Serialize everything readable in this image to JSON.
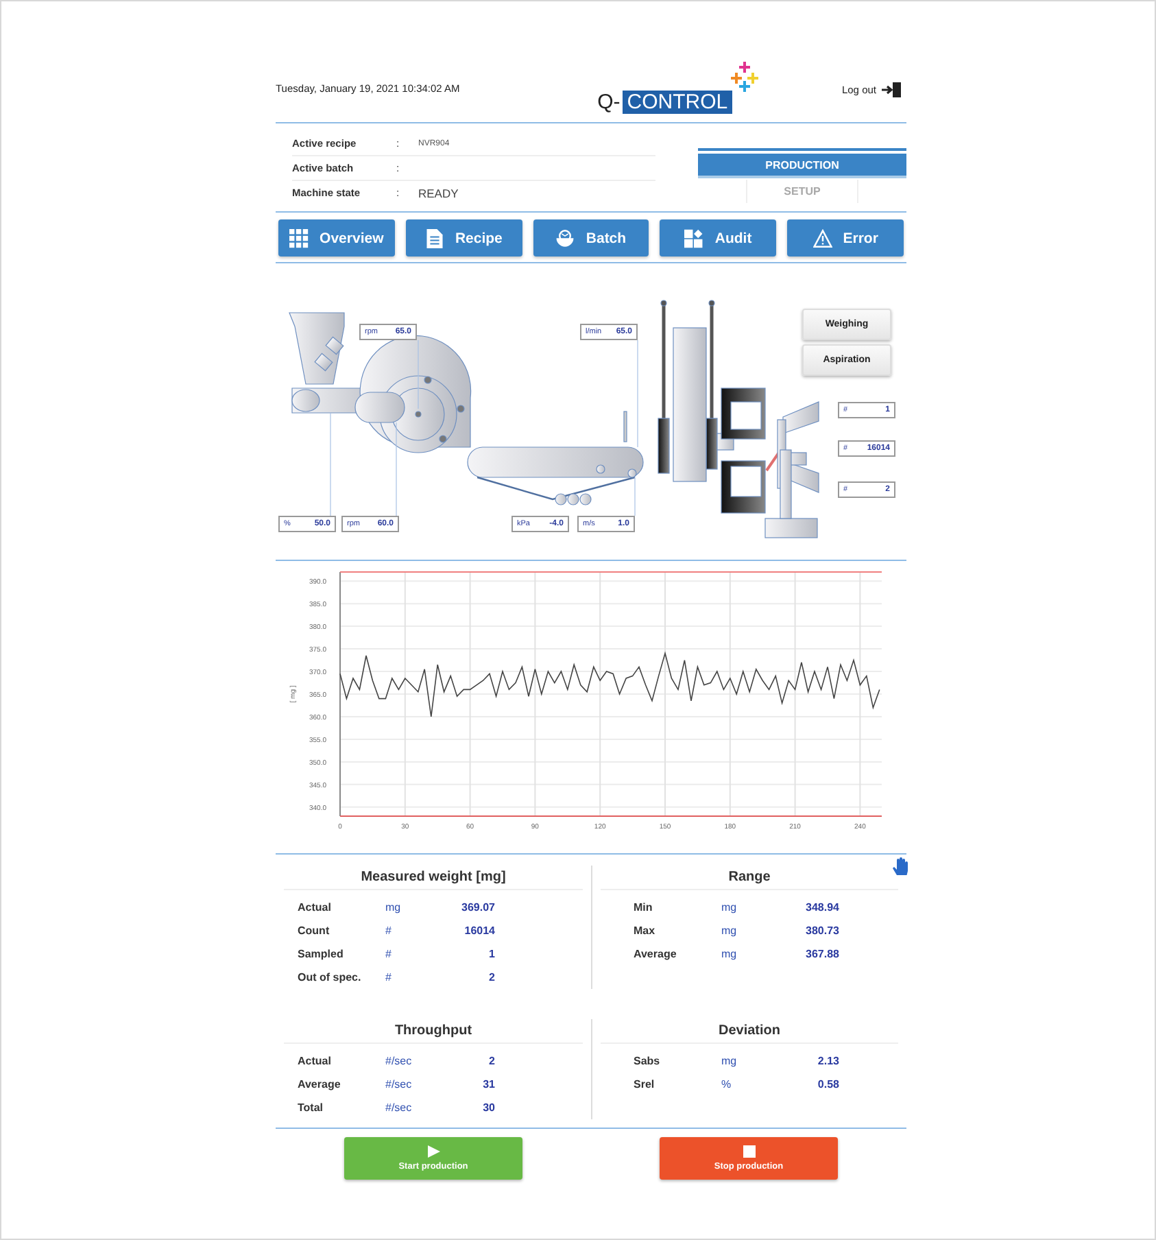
{
  "header": {
    "datetime": "Tuesday, January 19, 2021 10:34:02 AM",
    "logo": {
      "prefix": "Q-",
      "name": "CONTROL"
    },
    "logout": "Log out"
  },
  "info": [
    {
      "label": "Active recipe",
      "sep": ":",
      "value": "NVR904",
      "kind": "small"
    },
    {
      "label": "Active batch",
      "sep": ":"
    },
    {
      "label": "Machine state",
      "sep": ":",
      "value": "READY",
      "kind": "large"
    }
  ],
  "modes": [
    {
      "label": "PRODUCTION",
      "selected": true
    },
    {
      "label": "SETUP",
      "selected": false
    }
  ],
  "nav": [
    {
      "label": "Overview",
      "kind": "grid"
    },
    {
      "label": "Recipe",
      "kind": "document"
    },
    {
      "label": "Batch",
      "kind": "bowl"
    },
    {
      "label": "Audit",
      "kind": "audit"
    },
    {
      "label": "Error",
      "kind": "warning"
    }
  ],
  "diagram": {
    "readouts": [
      {
        "unit": "rpm",
        "value": "65.0"
      },
      {
        "unit": "l/min",
        "value": "65.0"
      },
      {
        "unit": "%",
        "value": "50.0"
      },
      {
        "unit": "rpm",
        "value": "60.0"
      },
      {
        "unit": "kPa",
        "value": "-4.0"
      },
      {
        "unit": "m/s",
        "value": "1.0"
      },
      {
        "unit": "#",
        "value": "1"
      },
      {
        "unit": "#",
        "value": "16014"
      },
      {
        "unit": "#",
        "value": "2"
      }
    ],
    "buttons": [
      "Weighing",
      "Aspiration"
    ]
  },
  "chart": {
    "chart_data": {
      "type": "line",
      "ylabel": "[ mg ]",
      "xlim": [
        0,
        250
      ],
      "grid": true,
      "ylim": [
        338,
        392
      ],
      "xticks": [
        0,
        30,
        60,
        90,
        120,
        150,
        180,
        210,
        240
      ],
      "yticks": [
        {
          "value": 340,
          "label": "340.0"
        },
        {
          "value": 345,
          "label": "345.0"
        },
        {
          "value": 350,
          "label": "350.0"
        },
        {
          "value": 355,
          "label": "355.0"
        },
        {
          "value": 360,
          "label": "360.0"
        },
        {
          "value": 365,
          "label": "365.0"
        },
        {
          "value": 370,
          "label": "370.0"
        },
        {
          "value": 375,
          "label": "375.0"
        },
        {
          "value": 380,
          "label": "380.0"
        },
        {
          "value": 385,
          "label": "385.0"
        },
        {
          "value": 390,
          "label": "390.0"
        }
      ],
      "x": [
        0,
        3,
        6,
        9,
        12,
        15,
        18,
        21,
        24,
        27,
        30,
        33,
        36,
        39,
        42,
        45,
        48,
        51,
        54,
        57,
        60,
        63,
        66,
        69,
        72,
        75,
        78,
        81,
        84,
        87,
        90,
        93,
        96,
        99,
        102,
        105,
        108,
        111,
        114,
        117,
        120,
        123,
        126,
        129,
        132,
        135,
        138,
        141,
        144,
        147,
        150,
        153,
        156,
        159,
        162,
        165,
        168,
        171,
        174,
        177,
        180,
        183,
        186,
        189,
        192,
        195,
        198,
        201,
        204,
        207,
        210,
        213,
        216,
        219,
        222,
        225,
        228,
        231,
        234,
        237,
        240,
        243,
        246,
        249
      ],
      "series": [
        {
          "color": "#444444",
          "values": [
            369.5,
            364,
            368.5,
            366,
            373.5,
            368,
            364,
            364,
            368.5,
            366,
            368.5,
            367,
            365.5,
            370.5,
            360,
            371.5,
            365.5,
            369,
            364.5,
            366,
            366,
            367,
            368,
            369.5,
            364.5,
            370,
            366,
            367.5,
            371,
            364.5,
            370.5,
            365,
            370,
            367.5,
            370,
            366,
            371.5,
            367,
            365.5,
            371,
            368,
            370,
            369.5,
            365,
            368.5,
            369,
            371,
            367,
            363.5,
            369,
            374,
            368.5,
            366,
            372.5,
            363.5,
            371,
            367,
            367.5,
            370,
            366,
            368.5,
            365,
            370,
            365.5,
            370.5,
            368,
            366,
            369,
            363,
            368,
            366,
            372,
            365.5,
            370,
            366,
            371,
            364,
            371.5,
            368,
            372.5,
            367,
            369,
            362,
            366
          ]
        }
      ]
    }
  },
  "stats": [
    {
      "title": "Measured weight [mg]",
      "rows": [
        {
          "label": "Actual",
          "unit": "mg",
          "value": "369.07"
        },
        {
          "label": "Count",
          "unit": "#",
          "value": "16014"
        },
        {
          "label": "Sampled",
          "unit": "#",
          "value": "1"
        },
        {
          "label": "Out of spec.",
          "unit": "#",
          "value": "2"
        }
      ]
    },
    {
      "title": "Range",
      "rows": [
        {
          "label": "Min",
          "unit": "mg",
          "value": "348.94"
        },
        {
          "label": "Max",
          "unit": "mg",
          "value": "380.73"
        },
        {
          "label": "Average",
          "unit": "mg",
          "value": "367.88"
        }
      ]
    },
    {
      "title": "Throughput",
      "rows": [
        {
          "label": "Actual",
          "unit": "#/sec",
          "value": "2"
        },
        {
          "label": "Average",
          "unit": "#/sec",
          "value": "31"
        },
        {
          "label": "Total",
          "unit": "#/sec",
          "value": "30"
        }
      ]
    },
    {
      "title": "Deviation",
      "rows": [
        {
          "label": "Sabs",
          "unit": "mg",
          "value": "2.13"
        },
        {
          "label": "Srel",
          "unit": "%",
          "value": "0.58"
        }
      ]
    }
  ],
  "actions": [
    {
      "label": "Start production",
      "kind": "start"
    },
    {
      "label": "Stop production",
      "kind": "stop"
    }
  ]
}
